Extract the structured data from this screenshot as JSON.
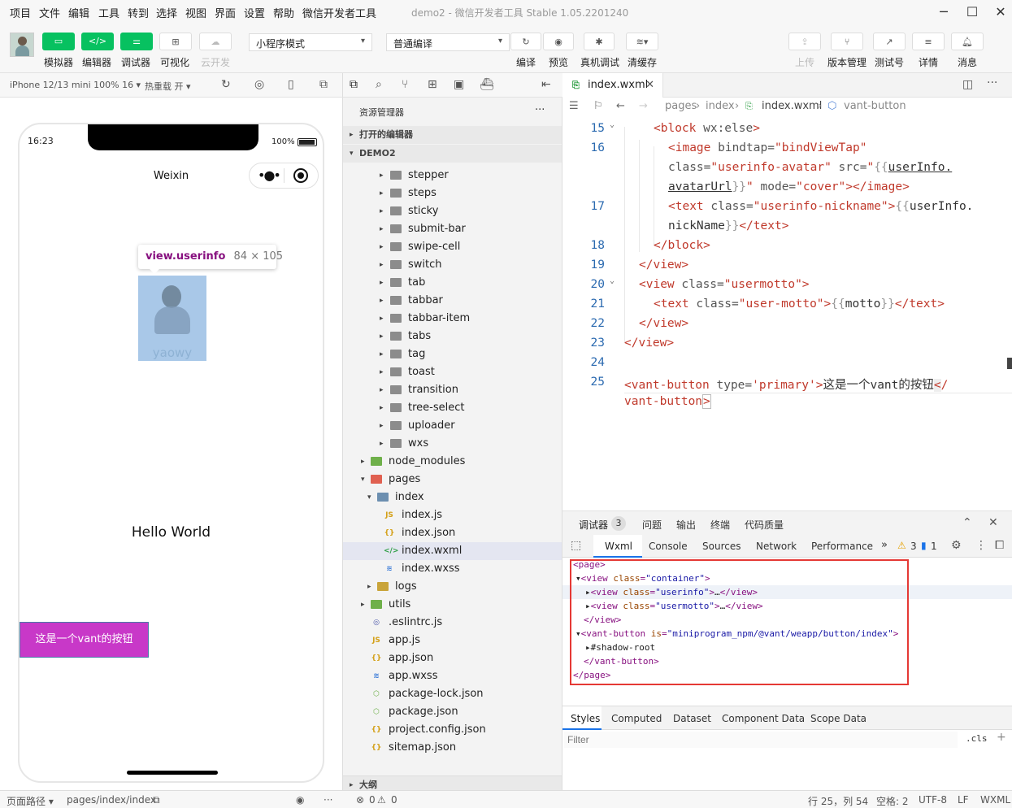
{
  "menu": [
    "项目",
    "文件",
    "编辑",
    "工具",
    "转到",
    "选择",
    "视图",
    "界面",
    "设置",
    "帮助",
    "微信开发者工具"
  ],
  "window_title": "demo2 - 微信开发者工具 Stable 1.05.2201240",
  "toolbar": {
    "left_buttons": [
      {
        "label": "模拟器",
        "icon": "phone-icon"
      },
      {
        "label": "编辑器",
        "icon": "code-icon"
      },
      {
        "label": "调试器",
        "icon": "debug-icon"
      },
      {
        "label": "可视化",
        "icon": "grid-icon"
      },
      {
        "label": "云开发",
        "icon": "cloud-icon"
      }
    ],
    "mode_select": "小程序模式",
    "compile_select": "普通编译",
    "mid_buttons": [
      {
        "label": "编译",
        "icon": "refresh-icon"
      },
      {
        "label": "预览",
        "icon": "eye-icon"
      },
      {
        "label": "真机调试",
        "icon": "bug-icon"
      },
      {
        "label": "清缓存",
        "icon": "layers-icon"
      }
    ],
    "right_buttons": [
      {
        "label": "上传",
        "icon": "upload-icon"
      },
      {
        "label": "版本管理",
        "icon": "branch-icon"
      },
      {
        "label": "测试号",
        "icon": "external-icon"
      },
      {
        "label": "详情",
        "icon": "menu-icon"
      },
      {
        "label": "消息",
        "icon": "bell-icon"
      }
    ]
  },
  "simulator": {
    "device": "iPhone 12/13 mini 100% 16 ▾",
    "hot_reload": "热重载 开 ▾",
    "status_time": "16:23",
    "battery": "100%",
    "nav_title": "Weixin",
    "tooltip_name": "view.userinfo",
    "tooltip_size": "84 × 105",
    "avatar_caption": "yaowy",
    "hello": "Hello World",
    "vant_button": "这是一个vant的按钮"
  },
  "explorer": {
    "title": "资源管理器",
    "more": "···",
    "open_editors": "打开的编辑器",
    "project": "DEMO2",
    "vant_folders": [
      "stepper",
      "steps",
      "sticky",
      "submit-bar",
      "swipe-cell",
      "switch",
      "tab",
      "tabbar",
      "tabbar-item",
      "tabs",
      "tag",
      "toast",
      "transition",
      "tree-select",
      "uploader",
      "wxs"
    ],
    "node_modules": "node_modules",
    "pages": "pages",
    "index_folder": "index",
    "index_files": [
      {
        "name": "index.js",
        "badge": "JS",
        "color": "#d4a017"
      },
      {
        "name": "index.json",
        "badge": "{}",
        "color": "#d4a017"
      },
      {
        "name": "index.wxml",
        "badge": "</>",
        "color": "#2e9e44"
      },
      {
        "name": "index.wxss",
        "badge": "≋",
        "color": "#3d7dd8"
      }
    ],
    "logs": "logs",
    "utils": "utils",
    "root_files": [
      {
        "name": ".eslintrc.js",
        "badge": "◎",
        "color": "#4a55a8"
      },
      {
        "name": "app.js",
        "badge": "JS",
        "color": "#d4a017"
      },
      {
        "name": "app.json",
        "badge": "{}",
        "color": "#d4a017"
      },
      {
        "name": "app.wxss",
        "badge": "≋",
        "color": "#3d7dd8"
      },
      {
        "name": "package-lock.json",
        "badge": "⬡",
        "color": "#6fb04a"
      },
      {
        "name": "package.json",
        "badge": "⬡",
        "color": "#6fb04a"
      },
      {
        "name": "project.config.json",
        "badge": "{}",
        "color": "#d4a017"
      },
      {
        "name": "sitemap.json",
        "badge": "{}",
        "color": "#d4a017"
      }
    ],
    "outline": "大纲"
  },
  "editor": {
    "tab": "index.wxml",
    "breadcrumb": [
      "pages",
      "index",
      "index.wxml",
      "vant-button"
    ],
    "line_numbers": [
      "15",
      "16",
      "17",
      "18",
      "19",
      "20",
      "21",
      "22",
      "23",
      "24",
      "25"
    ]
  },
  "devtools": {
    "top_tabs": [
      "调试器",
      "问题",
      "输出",
      "终端",
      "代码质量"
    ],
    "badge": "3",
    "sub_tabs": [
      "Wxml",
      "Console",
      "Sources",
      "Network",
      "Performance"
    ],
    "warn_count": "3",
    "info_count": "1",
    "styles_tabs": [
      "Styles",
      "Computed",
      "Dataset",
      "Component Data",
      "Scope Data"
    ],
    "filter_placeholder": "Filter",
    "cls": ".cls"
  },
  "statusbar": {
    "page_path_label": "页面路径 ▾",
    "page_path": "pages/index/index",
    "errors": "0",
    "warnings": "0",
    "position": "行 25，列 54",
    "spaces": "空格: 2",
    "encoding": "UTF-8",
    "eol": "LF",
    "language": "WXML"
  }
}
